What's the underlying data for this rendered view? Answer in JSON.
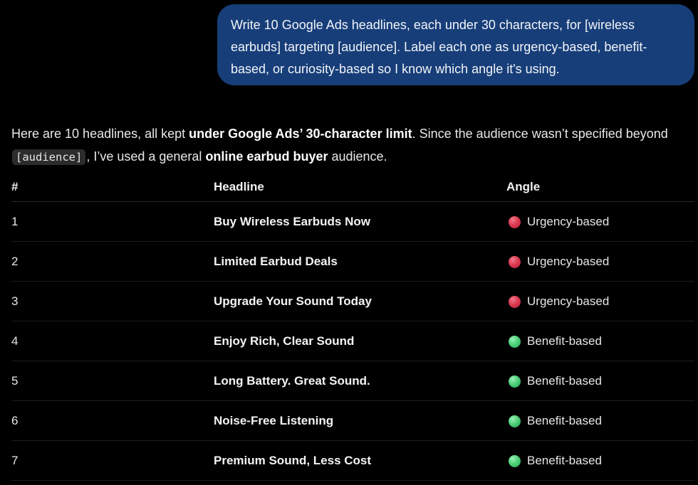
{
  "user_message": "Write 10 Google Ads headlines, each under 30 characters, for [wireless earbuds] targeting [audience]. Label each one as urgency-based, benefit-based, or curiosity-based so I know which angle it's using.",
  "response": {
    "intro": {
      "part1": "Here are 10 headlines, all kept ",
      "bold1": "under Google Ads’ 30-character limit",
      "part2": ". Since the audience wasn’t specified beyond ",
      "code": "[audience]",
      "part3": ", I’ve used a general ",
      "bold2": "online earbud buyer",
      "part4": " audience."
    },
    "table": {
      "headers": [
        "#",
        "Headline",
        "Angle"
      ],
      "rows": [
        {
          "num": "1",
          "headline": "Buy Wireless Earbuds Now",
          "angle": "Urgency-based",
          "icon": "red-circle-icon"
        },
        {
          "num": "2",
          "headline": "Limited Earbud Deals",
          "angle": "Urgency-based",
          "icon": "red-circle-icon"
        },
        {
          "num": "3",
          "headline": "Upgrade Your Sound Today",
          "angle": "Urgency-based",
          "icon": "red-circle-icon"
        },
        {
          "num": "4",
          "headline": "Enjoy Rich, Clear Sound",
          "angle": "Benefit-based",
          "icon": "green-circle-icon"
        },
        {
          "num": "5",
          "headline": "Long Battery. Great Sound.",
          "angle": "Benefit-based",
          "icon": "green-circle-icon"
        },
        {
          "num": "6",
          "headline": "Noise-Free Listening",
          "angle": "Benefit-based",
          "icon": "green-circle-icon"
        },
        {
          "num": "7",
          "headline": "Premium Sound, Less Cost",
          "angle": "Benefit-based",
          "icon": "green-circle-icon"
        }
      ]
    }
  },
  "colors": {
    "background": "#000000",
    "user_bubble": "#173e79",
    "urgency_dot": "#de3b52",
    "benefit_dot": "#4fd17a"
  }
}
